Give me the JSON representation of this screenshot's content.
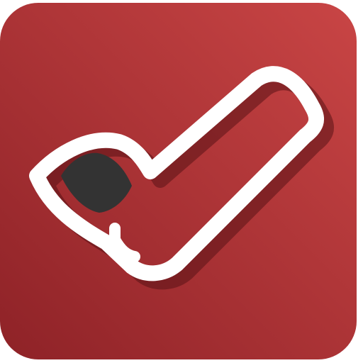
{
  "app_icon": {
    "icon": "checkmark-icon",
    "colors": {
      "background_top_right": "#c94545",
      "background_bottom_left": "#8e2227",
      "checkmark_outline": "#ffffff",
      "checkmark_shadow": "#5a1216",
      "leaf_fill": "#333333"
    }
  }
}
